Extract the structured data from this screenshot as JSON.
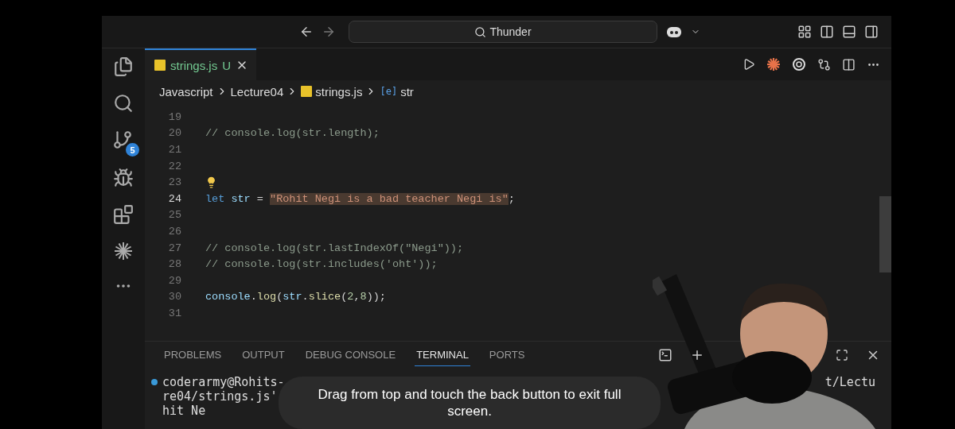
{
  "title_bar": {
    "search": "Thunder"
  },
  "tabs": [
    {
      "label": "strings.js",
      "status": "U",
      "selected": true
    }
  ],
  "breadcrumb": [
    {
      "label": "Javascript",
      "kind": "folder"
    },
    {
      "label": "Lecture04",
      "kind": "folder"
    },
    {
      "label": "strings.js",
      "kind": "file"
    },
    {
      "label": "str",
      "kind": "symbol",
      "icon": "[e]"
    }
  ],
  "activity_bar": {
    "scm_badge": "5"
  },
  "code_lines": [
    {
      "number": "19"
    },
    {
      "number": "20",
      "tokens": [
        {
          "text": "// console.log(str.length);",
          "kind": "comment"
        }
      ]
    },
    {
      "number": "21"
    },
    {
      "number": "22"
    },
    {
      "number": "23",
      "lightbulb": true
    },
    {
      "number": "24",
      "current": true,
      "tokens": [
        {
          "text": "let ",
          "kind": "keyword"
        },
        {
          "text": "str",
          "kind": "variable"
        },
        {
          "text": " = ",
          "kind": "plain"
        },
        {
          "text": "\"Rohit Negi is a bad teacher Negi is\"",
          "kind": "string",
          "highlighted": true
        },
        {
          "text": ";",
          "kind": "plain"
        }
      ]
    },
    {
      "number": "25"
    },
    {
      "number": "26"
    },
    {
      "number": "27",
      "tokens": [
        {
          "text": "// console.log(str.lastIndexOf(\"Negi\"));",
          "kind": "comment"
        }
      ]
    },
    {
      "number": "28",
      "tokens": [
        {
          "text": "// console.log(str.includes('oht'));",
          "kind": "comment"
        }
      ]
    },
    {
      "number": "29"
    },
    {
      "number": "30",
      "tokens": [
        {
          "text": "console",
          "kind": "variable"
        },
        {
          "text": ".",
          "kind": "plain"
        },
        {
          "text": "log",
          "kind": "function"
        },
        {
          "text": "(",
          "kind": "plain"
        },
        {
          "text": "str",
          "kind": "variable"
        },
        {
          "text": ".",
          "kind": "plain"
        },
        {
          "text": "slice",
          "kind": "function"
        },
        {
          "text": "(",
          "kind": "plain"
        },
        {
          "text": "2",
          "kind": "number"
        },
        {
          "text": ",",
          "kind": "plain"
        },
        {
          "text": "8",
          "kind": "number"
        },
        {
          "text": "));",
          "kind": "plain"
        }
      ]
    },
    {
      "number": "31"
    }
  ],
  "panel_tabs": [
    {
      "label": "PROBLEMS",
      "selected": false
    },
    {
      "label": "OUTPUT",
      "selected": false
    },
    {
      "label": "DEBUG CONSOLE",
      "selected": false
    },
    {
      "label": "TERMINAL",
      "selected": true
    },
    {
      "label": "PORTS",
      "selected": false
    }
  ],
  "terminal_lines": [
    {
      "text": "coderarmy@Rohits-",
      "prompt": true,
      "right": "t/Lectu"
    },
    {
      "text": "re04/strings.js'",
      "prompt": false
    },
    {
      "text": "hit Ne",
      "prompt": false
    }
  ],
  "toast": "Drag from top and touch the back button to exit full screen."
}
